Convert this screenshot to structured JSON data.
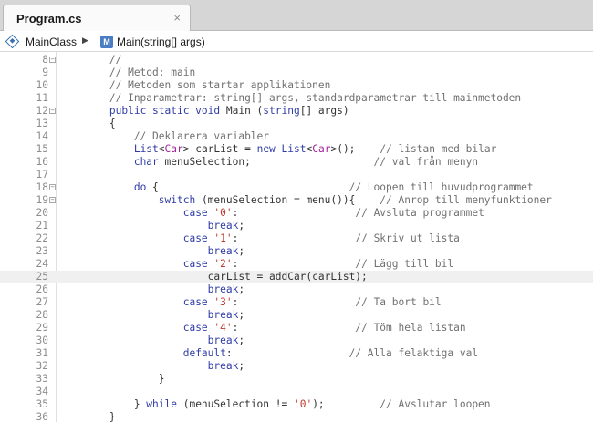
{
  "tab": {
    "title": "Program.cs",
    "close_label": "×"
  },
  "breadcrumb": {
    "class_name": "MainClass",
    "separator": "▶",
    "method_icon": "M",
    "method_name": "Main(string[] args)"
  },
  "editor": {
    "lines": [
      {
        "num": "8",
        "fold": "⊟",
        "tokens": [
          {
            "t": "        //",
            "c": "cm"
          }
        ]
      },
      {
        "num": "9",
        "tokens": [
          {
            "t": "        // Metod: main",
            "c": "cm"
          }
        ]
      },
      {
        "num": "10",
        "tokens": [
          {
            "t": "        // Metoden som startar applikationen",
            "c": "cm"
          }
        ]
      },
      {
        "num": "11",
        "tokens": [
          {
            "t": "        // Inparametrar: string[] args, standardparametrar till mainmetoden",
            "c": "cm"
          }
        ]
      },
      {
        "num": "12",
        "fold": "⊟",
        "tokens": [
          {
            "t": "        ",
            "c": "pl"
          },
          {
            "t": "public static void",
            "c": "kw"
          },
          {
            "t": " Main (",
            "c": "pl"
          },
          {
            "t": "string",
            "c": "kw"
          },
          {
            "t": "[] args)",
            "c": "pl"
          }
        ]
      },
      {
        "num": "13",
        "tokens": [
          {
            "t": "        {",
            "c": "pl"
          }
        ]
      },
      {
        "num": "14",
        "tokens": [
          {
            "t": "            // Deklarera variabler",
            "c": "cm"
          }
        ]
      },
      {
        "num": "15",
        "tokens": [
          {
            "t": "            ",
            "c": "pl"
          },
          {
            "t": "List",
            "c": "kw"
          },
          {
            "t": "<",
            "c": "pl"
          },
          {
            "t": "Car",
            "c": "ty"
          },
          {
            "t": "> carList = ",
            "c": "pl"
          },
          {
            "t": "new",
            "c": "kw"
          },
          {
            "t": " ",
            "c": "pl"
          },
          {
            "t": "List",
            "c": "kw"
          },
          {
            "t": "<",
            "c": "pl"
          },
          {
            "t": "Car",
            "c": "ty"
          },
          {
            "t": ">();    ",
            "c": "pl"
          },
          {
            "t": "// listan med bilar",
            "c": "cm"
          }
        ]
      },
      {
        "num": "16",
        "tokens": [
          {
            "t": "            ",
            "c": "pl"
          },
          {
            "t": "char",
            "c": "kw"
          },
          {
            "t": " menuSelection;                    ",
            "c": "pl"
          },
          {
            "t": "// val från menyn",
            "c": "cm"
          }
        ]
      },
      {
        "num": "17",
        "tokens": []
      },
      {
        "num": "18",
        "fold": "⊟",
        "tokens": [
          {
            "t": "            ",
            "c": "pl"
          },
          {
            "t": "do",
            "c": "kw"
          },
          {
            "t": " {                               ",
            "c": "pl"
          },
          {
            "t": "// Loopen till huvudprogrammet",
            "c": "cm"
          }
        ]
      },
      {
        "num": "19",
        "fold": "⊟",
        "tokens": [
          {
            "t": "                ",
            "c": "pl"
          },
          {
            "t": "switch",
            "c": "kw"
          },
          {
            "t": " (menuSelection = menu()){    ",
            "c": "pl"
          },
          {
            "t": "// Anrop till menyfunktioner",
            "c": "cm"
          }
        ]
      },
      {
        "num": "20",
        "tokens": [
          {
            "t": "                    ",
            "c": "pl"
          },
          {
            "t": "case",
            "c": "kw"
          },
          {
            "t": " ",
            "c": "pl"
          },
          {
            "t": "'0'",
            "c": "st"
          },
          {
            "t": ":                   ",
            "c": "pl"
          },
          {
            "t": "// Avsluta programmet",
            "c": "cm"
          }
        ]
      },
      {
        "num": "21",
        "tokens": [
          {
            "t": "                        ",
            "c": "pl"
          },
          {
            "t": "break",
            "c": "kw"
          },
          {
            "t": ";",
            "c": "pl"
          }
        ]
      },
      {
        "num": "22",
        "tokens": [
          {
            "t": "                    ",
            "c": "pl"
          },
          {
            "t": "case",
            "c": "kw"
          },
          {
            "t": " ",
            "c": "pl"
          },
          {
            "t": "'1'",
            "c": "st"
          },
          {
            "t": ":                   ",
            "c": "pl"
          },
          {
            "t": "// Skriv ut lista",
            "c": "cm"
          }
        ]
      },
      {
        "num": "23",
        "tokens": [
          {
            "t": "                        ",
            "c": "pl"
          },
          {
            "t": "break",
            "c": "kw"
          },
          {
            "t": ";",
            "c": "pl"
          }
        ]
      },
      {
        "num": "24",
        "tokens": [
          {
            "t": "                    ",
            "c": "pl"
          },
          {
            "t": "case",
            "c": "kw"
          },
          {
            "t": " ",
            "c": "pl"
          },
          {
            "t": "'2'",
            "c": "st"
          },
          {
            "t": ":                   ",
            "c": "pl"
          },
          {
            "t": "// Lägg till bil",
            "c": "cm"
          }
        ]
      },
      {
        "num": "25",
        "current": true,
        "tokens": [
          {
            "t": "                        carList = addCar(carList);",
            "c": "pl"
          }
        ]
      },
      {
        "num": "26",
        "tokens": [
          {
            "t": "                        ",
            "c": "pl"
          },
          {
            "t": "break",
            "c": "kw"
          },
          {
            "t": ";",
            "c": "pl"
          }
        ]
      },
      {
        "num": "27",
        "tokens": [
          {
            "t": "                    ",
            "c": "pl"
          },
          {
            "t": "case",
            "c": "kw"
          },
          {
            "t": " ",
            "c": "pl"
          },
          {
            "t": "'3'",
            "c": "st"
          },
          {
            "t": ":                   ",
            "c": "pl"
          },
          {
            "t": "// Ta bort bil",
            "c": "cm"
          }
        ]
      },
      {
        "num": "28",
        "tokens": [
          {
            "t": "                        ",
            "c": "pl"
          },
          {
            "t": "break",
            "c": "kw"
          },
          {
            "t": ";",
            "c": "pl"
          }
        ]
      },
      {
        "num": "29",
        "tokens": [
          {
            "t": "                    ",
            "c": "pl"
          },
          {
            "t": "case",
            "c": "kw"
          },
          {
            "t": " ",
            "c": "pl"
          },
          {
            "t": "'4'",
            "c": "st"
          },
          {
            "t": ":                   ",
            "c": "pl"
          },
          {
            "t": "// Töm hela listan",
            "c": "cm"
          }
        ]
      },
      {
        "num": "30",
        "tokens": [
          {
            "t": "                        ",
            "c": "pl"
          },
          {
            "t": "break",
            "c": "kw"
          },
          {
            "t": ";",
            "c": "pl"
          }
        ]
      },
      {
        "num": "31",
        "tokens": [
          {
            "t": "                    ",
            "c": "pl"
          },
          {
            "t": "default",
            "c": "kw"
          },
          {
            "t": ":                   ",
            "c": "pl"
          },
          {
            "t": "// Alla felaktiga val",
            "c": "cm"
          }
        ]
      },
      {
        "num": "32",
        "tokens": [
          {
            "t": "                        ",
            "c": "pl"
          },
          {
            "t": "break",
            "c": "kw"
          },
          {
            "t": ";",
            "c": "pl"
          }
        ]
      },
      {
        "num": "33",
        "tokens": [
          {
            "t": "                }",
            "c": "pl"
          }
        ]
      },
      {
        "num": "34",
        "tokens": []
      },
      {
        "num": "35",
        "tokens": [
          {
            "t": "            } ",
            "c": "pl"
          },
          {
            "t": "while",
            "c": "kw"
          },
          {
            "t": " (menuSelection != ",
            "c": "pl"
          },
          {
            "t": "'0'",
            "c": "st"
          },
          {
            "t": ");         ",
            "c": "pl"
          },
          {
            "t": "// Avslutar loopen",
            "c": "cm"
          }
        ]
      },
      {
        "num": "36",
        "tokens": [
          {
            "t": "        }",
            "c": "pl"
          }
        ]
      }
    ]
  }
}
